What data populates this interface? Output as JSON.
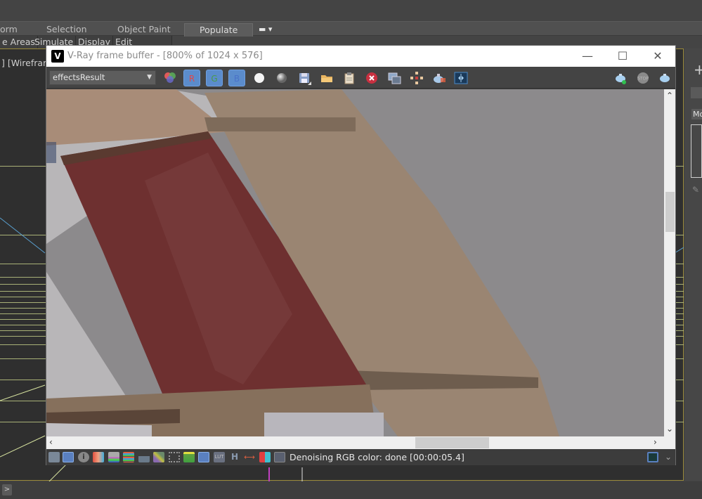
{
  "app": {
    "ribbon_tabs": [
      {
        "label": "orm",
        "active": false
      },
      {
        "label": "Selection",
        "active": false
      },
      {
        "label": "Object Paint",
        "active": false
      },
      {
        "label": "Populate",
        "active": true
      }
    ],
    "ribbon_subtabs": [
      "e Areas",
      "Simulate",
      "Display",
      "Edit Selected"
    ],
    "viewport_label": "] [Wirefram",
    "right_panel_label": "Mo"
  },
  "vfb": {
    "title": "V-Ray frame buffer - [800% of 1024 x 576]",
    "logo_glyph": "V",
    "window_controls": {
      "minimize": "—",
      "maximize": "☐",
      "close": "✕"
    },
    "channel_select": {
      "value": "effectsResult"
    },
    "toolbar": {
      "channel_buttons": [
        {
          "name": "red-channel",
          "label": "R",
          "color": "#e04848"
        },
        {
          "name": "green-channel",
          "label": "G",
          "color": "#4a9a4a"
        },
        {
          "name": "blue-channel",
          "label": "B",
          "color": "#4a72c8"
        }
      ],
      "icons": [
        "rgb-mode-icon",
        "white-mono-icon",
        "alpha-mono-icon",
        "save-icon",
        "open-icon",
        "clipboard-icon",
        "clear-icon",
        "duplicate-vfb-icon",
        "track-mouse-icon",
        "render-region-icon",
        "compare-icon"
      ],
      "right_icons": [
        "render-interactive-icon",
        "stop-icon",
        "render-icon"
      ]
    },
    "status_icons": [
      "display-correction-icon",
      "layers-icon",
      "info-icon",
      "color-balance-icon",
      "hsl-icon",
      "levels-icon",
      "histogram-icon",
      "curve-icon",
      "lens-effects-icon",
      "background-icon",
      "exposure-icon",
      "lut-icon",
      "h-icon",
      "white-balance-icon",
      "filmic-icon",
      "settings-icon"
    ],
    "status_text": "Denoising RGB color: done [00:00:05.4]",
    "scroll": {
      "horizontal_position": 0.6,
      "vertical_position": 0.3
    }
  },
  "colors": {
    "accent": "#5b8ccc",
    "viewport_border": "#9a8a3a",
    "red_material": "#6e3030",
    "beige_material": "#9a8570",
    "background_gray": "#8c8a8c"
  }
}
